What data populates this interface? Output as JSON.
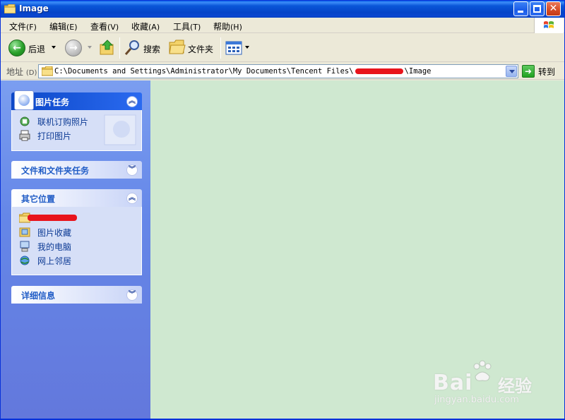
{
  "window": {
    "title": "Image"
  },
  "menubar": {
    "items": [
      {
        "label": "文件",
        "key": "(F)"
      },
      {
        "label": "编辑",
        "key": "(E)"
      },
      {
        "label": "查看",
        "key": "(V)"
      },
      {
        "label": "收藏",
        "key": "(A)"
      },
      {
        "label": "工具",
        "key": "(T)"
      },
      {
        "label": "帮助",
        "key": "(H)"
      }
    ]
  },
  "toolbar": {
    "back_label": "后退",
    "search_label": "搜索",
    "folders_label": "文件夹"
  },
  "address": {
    "label": "地址",
    "label_key": "(D)",
    "path_prefix": "C:\\Documents and Settings\\Administrator\\My Documents\\Tencent Files\\",
    "path_suffix": "\\Image",
    "go_label": "转到"
  },
  "taskpane": {
    "picture_tasks": {
      "title": "图片任务",
      "items": [
        "联机订购照片",
        "打印图片"
      ]
    },
    "file_folder_tasks": {
      "title": "文件和文件夹任务"
    },
    "other_places": {
      "title": "其它位置",
      "items": [
        "",
        "图片收藏",
        "我的电脑",
        "网上邻居"
      ]
    },
    "details": {
      "title": "详细信息"
    }
  },
  "watermark": {
    "brand": "Bai",
    "brand_suffix": "经验",
    "url": "jingyan.baidu.com"
  },
  "colors": {
    "title_bar": "#0a56d8",
    "task_pane": "#6b8ae6",
    "main_area": "#cfe8d0",
    "link_text": "#0c3a94",
    "redaction": "#e8141c"
  }
}
